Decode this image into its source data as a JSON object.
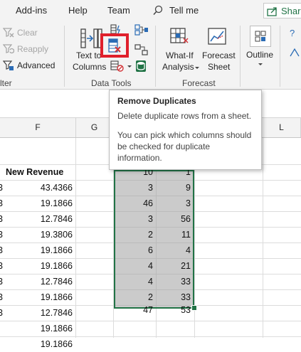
{
  "tabs": {
    "addins": "Add-ins",
    "help": "Help",
    "team": "Team",
    "tellme": "Tell me",
    "share": "Share"
  },
  "ribbon": {
    "sort_filter": {
      "clear": "Clear",
      "reapply": "Reapply",
      "advanced": "Advanced",
      "group_label_fragment": "lter"
    },
    "data_tools": {
      "text_to_columns_line1": "Text to",
      "text_to_columns_line2": "Columns",
      "group_label": "Data Tools"
    },
    "forecast": {
      "what_if_line1": "What-If",
      "what_if_line2": "Analysis",
      "forecast_sheet_line1": "Forecast",
      "forecast_sheet_line2": "Sheet",
      "group_label": "Forecast"
    },
    "outline": {
      "label": "Outline"
    }
  },
  "tooltip": {
    "title": "Remove Duplicates",
    "line1": "Delete duplicate rows from a sheet.",
    "line2": "You can pick which columns should",
    "line3": "be checked for duplicate",
    "line4": "information."
  },
  "columns": {
    "f": "F",
    "g": "G",
    "l": "L"
  },
  "sheet": {
    "f_header": "New Revenue",
    "f_values": [
      "43.4366",
      "19.1866",
      "12.7846",
      "19.3806",
      "19.1866",
      "19.1866",
      "12.7846",
      "19.1866",
      "12.7846",
      "19.1866",
      "19.1866"
    ],
    "edge_chars": [
      "3",
      "3",
      "3",
      "3",
      "3",
      "3",
      "3",
      "3",
      "3"
    ],
    "selection_col1": [
      "10",
      "3",
      "46",
      "3",
      "2",
      "6",
      "4",
      "4",
      "2",
      "47"
    ],
    "selection_col2": [
      "1",
      "9",
      "3",
      "56",
      "11",
      "4",
      "21",
      "33",
      "33",
      "53"
    ]
  },
  "colors": {
    "accent_green": "#217346",
    "highlight_red": "#e0202c",
    "selection_fill": "#a0a0a0"
  }
}
